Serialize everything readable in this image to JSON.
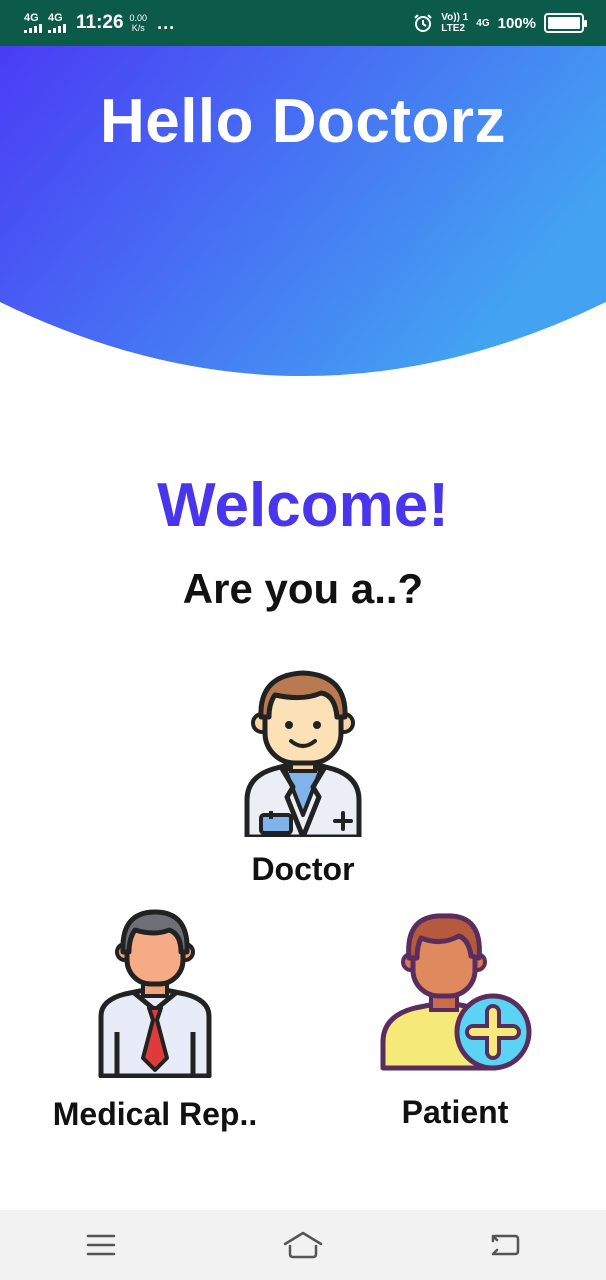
{
  "status_bar": {
    "signal1": "4G",
    "signal2": "4G",
    "time": "11:26",
    "speed_value": "0.00",
    "speed_unit": "K/s",
    "dots": "...",
    "volte": "Vo)) 1",
    "lte": "LTE2",
    "network": "4G",
    "battery": "100%"
  },
  "header": {
    "title": "Hello Doctorz",
    "gradient_start": "#4a3cf5",
    "gradient_end": "#43a3f2"
  },
  "welcome": {
    "heading": "Welcome!",
    "question": "Are you a..?"
  },
  "roles": [
    {
      "label": "Doctor",
      "icon": "doctor-icon"
    },
    {
      "label": "Medical Rep..",
      "icon": "medical-rep-icon"
    },
    {
      "label": "Patient",
      "icon": "patient-icon"
    }
  ],
  "nav_bar": {
    "icons": [
      "menu-icon",
      "home-icon",
      "back-icon"
    ]
  }
}
